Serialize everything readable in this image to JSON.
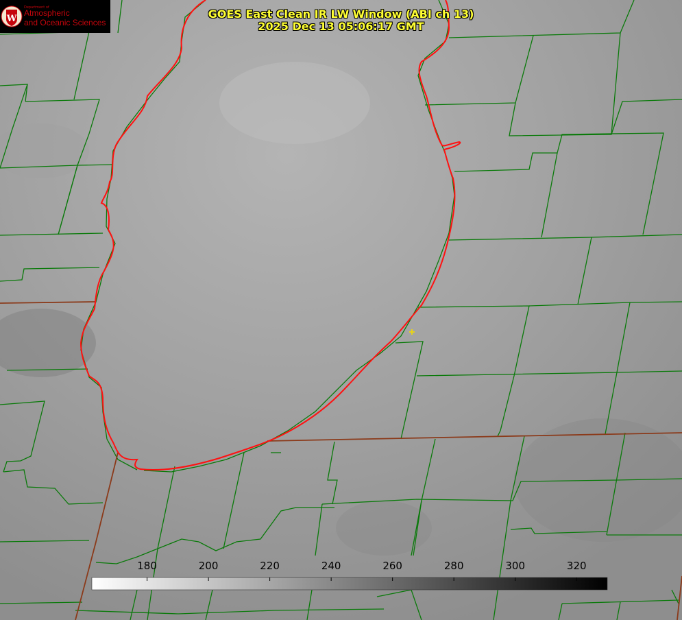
{
  "title": {
    "line1": "GOES East Clean IR LW Window (ABI ch 13)",
    "line2": "2025 Dec 13 05:06:17 GMT"
  },
  "logo": {
    "icon": "uw-crest-icon",
    "dept_line": "Department of",
    "line1": "Atmospheric",
    "line2": "and Oceanic Sciences",
    "color": "#c5050c"
  },
  "colorbar": {
    "ticks": [
      "180",
      "200",
      "220",
      "240",
      "260",
      "280",
      "300",
      "320"
    ],
    "tick_values": [
      180,
      200,
      220,
      240,
      260,
      280,
      300,
      320
    ],
    "range": [
      162,
      330
    ],
    "gradient": "white-to-black"
  },
  "colors": {
    "county_lines": "#0a7a0a",
    "state_lines": "#8b3a1a",
    "lake_shore": "#ff1111",
    "marker": "#e6d21a",
    "title_text": "#ffff33"
  }
}
